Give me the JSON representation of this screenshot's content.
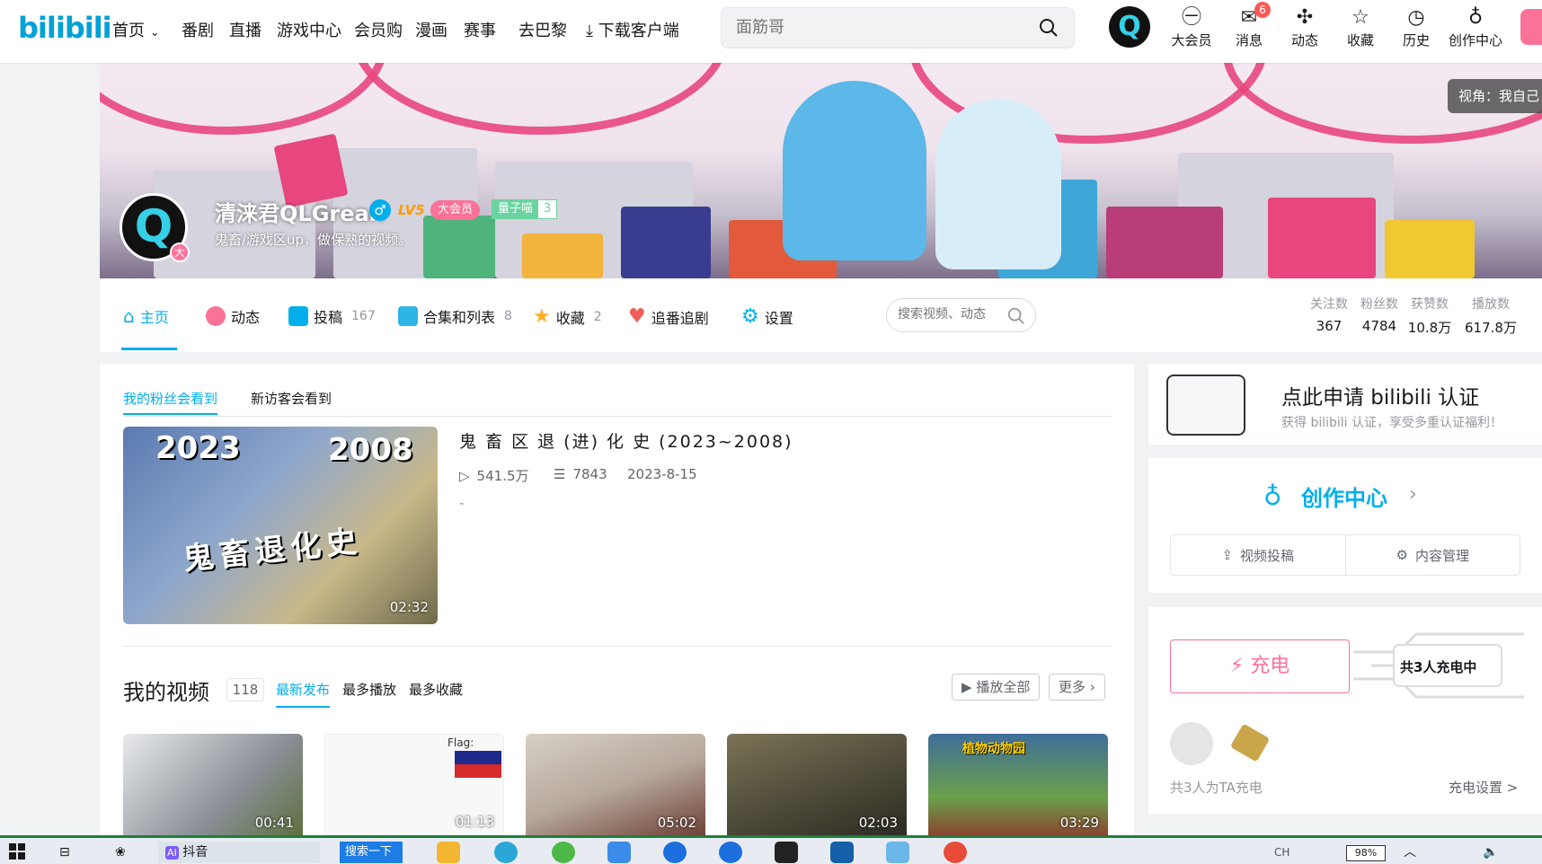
{
  "nav": {
    "logo": "bilibili",
    "items": [
      "首页",
      "番剧",
      "直播",
      "游戏中心",
      "会员购",
      "漫画",
      "赛事",
      "去巴黎"
    ],
    "home_chevron": "⌄",
    "download": "下载客户端",
    "search_placeholder": "面筋哥",
    "avatar_letter": "Q",
    "right": [
      {
        "label": "大会员",
        "icon": "vip-icon"
      },
      {
        "label": "消息",
        "icon": "message-icon",
        "badge": "6"
      },
      {
        "label": "动态",
        "icon": "feed-icon"
      },
      {
        "label": "收藏",
        "icon": "star-icon"
      },
      {
        "label": "历史",
        "icon": "clock-icon"
      },
      {
        "label": "创作中心",
        "icon": "lightbulb-icon"
      }
    ]
  },
  "banner": {
    "view_label": "视角：我自己",
    "user_name": "清涞君QLGrean",
    "avatar_letter": "Q",
    "avatar_badge": "大",
    "gender_symbol": "♂",
    "level": "LV5",
    "vip_label": "大会员",
    "fan_badge_name": "量子喵",
    "fan_badge_level": "3",
    "sign": "鬼畜/游戏区up，做保熟的视频。"
  },
  "tabs": [
    {
      "label": "主页",
      "count": ""
    },
    {
      "label": "动态",
      "count": ""
    },
    {
      "label": "投稿",
      "count": "167"
    },
    {
      "label": "合集和列表",
      "count": "8"
    },
    {
      "label": "收藏",
      "count": "2"
    },
    {
      "label": "追番追剧",
      "count": ""
    },
    {
      "label": "设置",
      "count": ""
    }
  ],
  "tab_search_placeholder": "搜索视频、动态",
  "stats": [
    {
      "label": "关注数",
      "value": "367"
    },
    {
      "label": "粉丝数",
      "value": "4784"
    },
    {
      "label": "获赞数",
      "value": "10.8万"
    },
    {
      "label": "播放数",
      "value": "617.8万"
    }
  ],
  "main": {
    "subtabs": [
      "我的粉丝会看到",
      "新访客会看到"
    ],
    "featured": {
      "title": "鬼 畜 区 退 (进) 化 史 (2023~2008)",
      "views": "541.5万",
      "danmaku": "7843",
      "date": "2023-8-15",
      "desc": "-",
      "duration": "02:32",
      "overlay_left": "2023",
      "overlay_right": "2008",
      "overlay_center": "鬼畜退化史"
    },
    "videos_title": "我的视频",
    "videos_count": "118",
    "sort_tabs": [
      "最新发布",
      "最多播放",
      "最多收藏"
    ],
    "play_all": "播放全部",
    "more": "更多",
    "thumbs": [
      {
        "duration": "00:41",
        "color": "#8a8f96"
      },
      {
        "duration": "01:13",
        "color": "#f4f4f4",
        "text": "Flag:"
      },
      {
        "duration": "05:02",
        "color": "#b7a89c"
      },
      {
        "duration": "02:03",
        "color": "#4a4636"
      },
      {
        "duration": "03:29",
        "color": "#3f6e9a",
        "text": "植物动物园"
      }
    ]
  },
  "right": {
    "cert_title": "点此申请 bilibili 认证",
    "cert_sub": "获得 bilibili 认证，享受多重认证福利！",
    "creator_title": "创作中心",
    "creator_btns": [
      "视频投稿",
      "内容管理"
    ],
    "charge_btn": "充电",
    "charge_count": "共3人充电中",
    "charge_footer": "共3人为TA充电",
    "charge_setting": "充电设置 >"
  },
  "taskbar": {
    "douyin": "抖音",
    "search": "搜索一下",
    "lang": "CH",
    "battery": "98%"
  },
  "colors": {
    "accent": "#00aeec",
    "pink": "#fb7299"
  }
}
